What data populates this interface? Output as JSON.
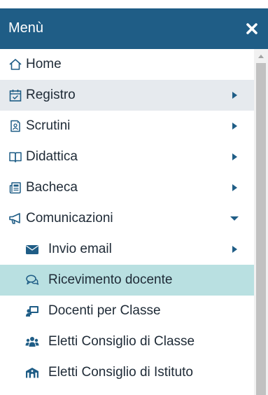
{
  "header": {
    "title": "Menù",
    "close_icon": "close-icon"
  },
  "colors": {
    "header_bg": "#1f5d86",
    "accent": "#1f5d86",
    "highlight": "#e6eaee",
    "active": "#b9e0e1"
  },
  "menu": {
    "items": [
      {
        "label": "Home",
        "icon": "home-icon"
      },
      {
        "label": "Registro",
        "icon": "calendar-check-icon",
        "arrow": "right"
      },
      {
        "label": "Scrutini",
        "icon": "scrutini-icon",
        "arrow": "right"
      },
      {
        "label": "Didattica",
        "icon": "book-icon",
        "arrow": "right"
      },
      {
        "label": "Bacheca",
        "icon": "newspaper-icon",
        "arrow": "right"
      },
      {
        "label": "Comunicazioni",
        "icon": "megaphone-icon",
        "arrow": "down"
      },
      {
        "label": "Invio email",
        "icon": "envelope-icon",
        "arrow": "right"
      },
      {
        "label": "Ricevimento docente",
        "icon": "comments-icon"
      },
      {
        "label": "Docenti per Classe",
        "icon": "chalkboard-teacher-icon"
      },
      {
        "label": "Eletti Consiglio di Classe",
        "icon": "users-icon"
      },
      {
        "label": "Eletti Consiglio di Istituto",
        "icon": "school-icon"
      }
    ]
  }
}
